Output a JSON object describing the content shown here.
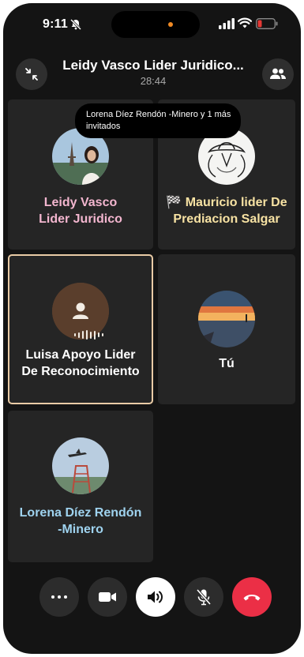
{
  "status_bar": {
    "time": "9:11",
    "icons": [
      "bell-slash-icon",
      "cellular-signal-icon",
      "wifi-icon",
      "battery-low-icon"
    ],
    "battery_color": "#e53935"
  },
  "header": {
    "title": "Leidy Vasco Lider Juridico...",
    "timer": "28:44",
    "left_icon": "minimize-arrows-icon",
    "right_icon": "participants-icon"
  },
  "tooltip": {
    "text": "Lorena Díez Rendón -Minero y 1 más invitados"
  },
  "participants": [
    {
      "line1": "Leidy Vasco",
      "line2": "Lider Juridico",
      "color": "#f3b6cf",
      "avatar": "photo-woman-eiffel"
    },
    {
      "line1": "🏁 Mauricio lider De",
      "line2": "Prediacion Salgar",
      "color": "#f7e2a3",
      "avatar": "photo-drawing-hat"
    },
    {
      "line1": "Luisa Apoyo Lider",
      "line2": "De Reconocimiento",
      "color": "#ffffff",
      "avatar": "default-person-icon",
      "speaking": true
    },
    {
      "line1": "Tú",
      "line2": "",
      "color": "#ffffff",
      "avatar": "photo-sunset-sea"
    },
    {
      "line1": "Lorena Díez Rendón",
      "line2": "-Minero",
      "color": "#9fd3ef",
      "avatar": "photo-plane-tower"
    }
  ],
  "controls": [
    {
      "name": "more",
      "icon": "more-dots-icon"
    },
    {
      "name": "video",
      "icon": "video-camera-icon"
    },
    {
      "name": "speaker",
      "icon": "speaker-icon"
    },
    {
      "name": "mute",
      "icon": "microphone-off-icon"
    },
    {
      "name": "end-call",
      "icon": "phone-hangup-icon",
      "color": "#eb2f46"
    }
  ]
}
